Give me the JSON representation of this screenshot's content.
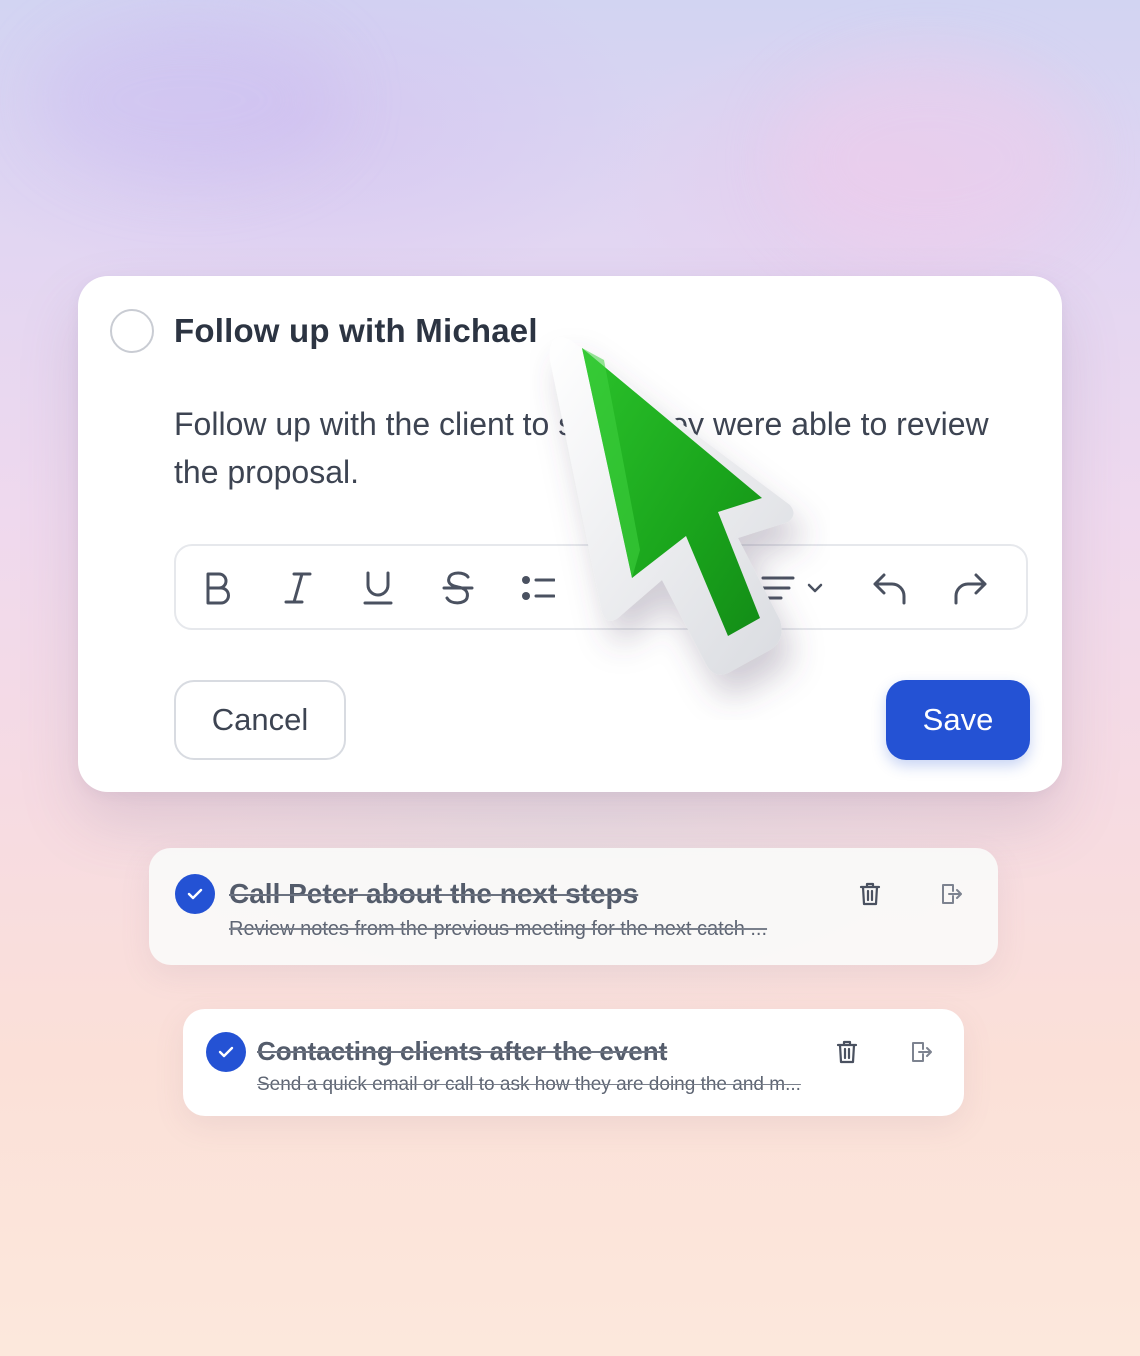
{
  "editor": {
    "title": "Follow up with Michael",
    "body": "Follow up with the client to see if they were able to review the proposal.",
    "toolbar": {
      "bold_icon": "bold-icon",
      "italic_icon": "italic-icon",
      "underline_icon": "underline-icon",
      "strikethrough_icon": "strikethrough-icon",
      "bullet_list_icon": "bullet-list-icon",
      "numbered_list_icon": "numbered-list-icon",
      "align_icon": "align-left-icon",
      "undo_icon": "undo-icon",
      "redo_icon": "redo-icon"
    },
    "cancel_label": "Cancel",
    "save_label": "Save"
  },
  "tasks": [
    {
      "title": "Call Peter about the next steps",
      "subtitle": "Review notes from the previous meeting for the next catch ...",
      "completed": true
    },
    {
      "title": "Contacting clients after the event",
      "subtitle": "Send a quick email or call to ask how they are doing the and m...",
      "completed": true
    }
  ],
  "colors": {
    "accent": "#2452d4",
    "cursor_green": "#1fa51f"
  }
}
